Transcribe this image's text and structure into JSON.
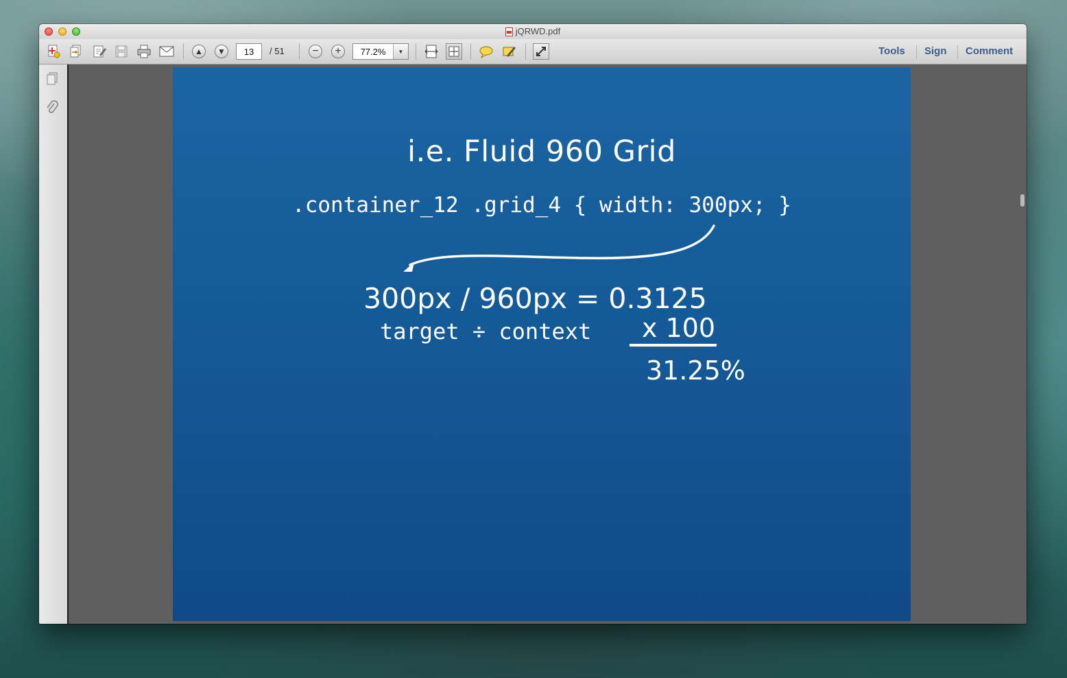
{
  "window": {
    "title": "jQRWD.pdf"
  },
  "toolbar": {
    "buttons": [
      {
        "name": "create-pdf-icon"
      },
      {
        "name": "combine-files-icon"
      },
      {
        "name": "edit-document-icon"
      },
      {
        "name": "save-icon"
      },
      {
        "name": "print-icon"
      },
      {
        "name": "email-icon"
      },
      {
        "name": "previous-page-icon"
      },
      {
        "name": "next-page-icon"
      },
      {
        "name": "zoom-out-icon"
      },
      {
        "name": "zoom-in-icon"
      },
      {
        "name": "fit-width-icon"
      },
      {
        "name": "fit-page-icon"
      },
      {
        "name": "comment-note-icon"
      },
      {
        "name": "highlight-icon"
      },
      {
        "name": "full-screen-icon"
      }
    ],
    "page_current": "13",
    "page_total": "/ 51",
    "zoom": "77.2%",
    "tools_label": "Tools",
    "sign_label": "Sign",
    "comment_label": "Comment"
  },
  "sidebar": {
    "icons": [
      "pages-icon",
      "attachments-icon"
    ]
  },
  "slide": {
    "title": "i.e. Fluid 960 Grid",
    "code": ".container_12 .grid_4 { width: 300px; }",
    "equation": "300px / 960px = 0.3125",
    "formula": "target ÷ context",
    "multiplier": "x 100",
    "result": "31.25%",
    "background_color": "#155a98"
  }
}
